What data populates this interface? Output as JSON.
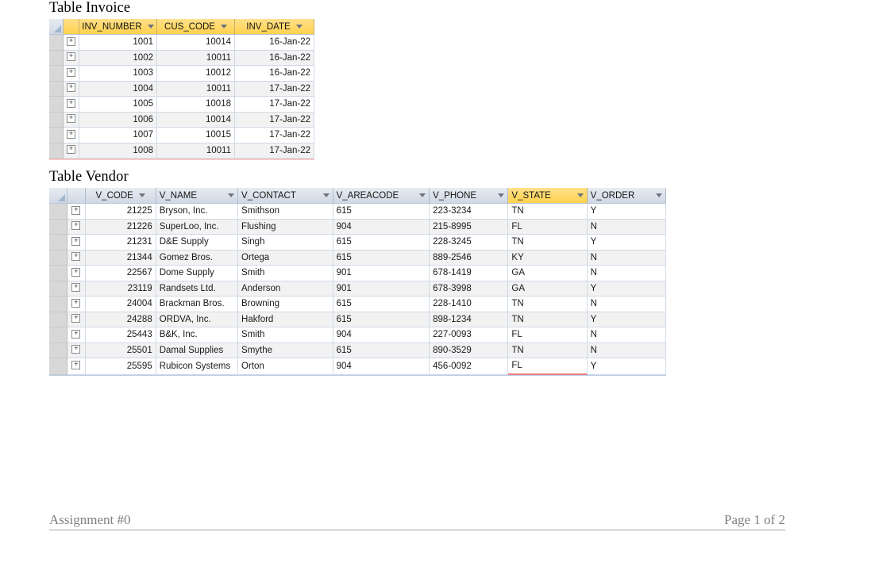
{
  "document": {
    "footer": {
      "left_text": "Assignment #0",
      "right_text": "Page 1 of 2"
    }
  },
  "invoice_section": {
    "title": "Table Invoice",
    "table": {
      "name": "Invoice",
      "columns": [
        {
          "key": "INV_NUMBER",
          "label": "INV_NUMBER",
          "align": "right",
          "highlighted": true
        },
        {
          "key": "CUS_CODE",
          "label": "CUS_CODE",
          "align": "right",
          "highlighted": true
        },
        {
          "key": "INV_DATE",
          "label": "INV_DATE",
          "align": "right",
          "highlighted": true
        }
      ],
      "rows": [
        {
          "INV_NUMBER": "1001",
          "CUS_CODE": "10014",
          "INV_DATE": "16-Jan-22"
        },
        {
          "INV_NUMBER": "1002",
          "CUS_CODE": "10011",
          "INV_DATE": "16-Jan-22"
        },
        {
          "INV_NUMBER": "1003",
          "CUS_CODE": "10012",
          "INV_DATE": "16-Jan-22"
        },
        {
          "INV_NUMBER": "1004",
          "CUS_CODE": "10011",
          "INV_DATE": "17-Jan-22"
        },
        {
          "INV_NUMBER": "1005",
          "CUS_CODE": "10018",
          "INV_DATE": "17-Jan-22"
        },
        {
          "INV_NUMBER": "1006",
          "CUS_CODE": "10014",
          "INV_DATE": "17-Jan-22"
        },
        {
          "INV_NUMBER": "1007",
          "CUS_CODE": "10015",
          "INV_DATE": "17-Jan-22"
        },
        {
          "INV_NUMBER": "1008",
          "CUS_CODE": "10011",
          "INV_DATE": "17-Jan-22"
        }
      ],
      "expand_glyph": "+"
    }
  },
  "vendor_section": {
    "title": "Table Vendor",
    "table": {
      "name": "Vendor",
      "columns": [
        {
          "key": "V_CODE",
          "label": "V_CODE",
          "align": "right",
          "highlighted": false
        },
        {
          "key": "V_NAME",
          "label": "V_NAME",
          "align": "left",
          "highlighted": false
        },
        {
          "key": "V_CONTACT",
          "label": "V_CONTACT",
          "align": "left",
          "highlighted": false
        },
        {
          "key": "V_AREACODE",
          "label": "V_AREACODE",
          "align": "left",
          "highlighted": false
        },
        {
          "key": "V_PHONE",
          "label": "V_PHONE",
          "align": "left",
          "highlighted": false
        },
        {
          "key": "V_STATE",
          "label": "V_STATE",
          "align": "left",
          "highlighted": true
        },
        {
          "key": "V_ORDER",
          "label": "V_ORDER",
          "align": "left",
          "highlighted": false
        }
      ],
      "rows": [
        {
          "V_CODE": "21225",
          "V_NAME": "Bryson, Inc.",
          "V_CONTACT": "Smithson",
          "V_AREACODE": "615",
          "V_PHONE": "223-3234",
          "V_STATE": "TN",
          "V_ORDER": "Y"
        },
        {
          "V_CODE": "21226",
          "V_NAME": "SuperLoo, Inc.",
          "V_CONTACT": "Flushing",
          "V_AREACODE": "904",
          "V_PHONE": "215-8995",
          "V_STATE": "FL",
          "V_ORDER": "N"
        },
        {
          "V_CODE": "21231",
          "V_NAME": "D&E Supply",
          "V_CONTACT": "Singh",
          "V_AREACODE": "615",
          "V_PHONE": "228-3245",
          "V_STATE": "TN",
          "V_ORDER": "Y"
        },
        {
          "V_CODE": "21344",
          "V_NAME": "Gomez Bros.",
          "V_CONTACT": "Ortega",
          "V_AREACODE": "615",
          "V_PHONE": "889-2546",
          "V_STATE": "KY",
          "V_ORDER": "N"
        },
        {
          "V_CODE": "22567",
          "V_NAME": "Dome Supply",
          "V_CONTACT": "Smith",
          "V_AREACODE": "901",
          "V_PHONE": "678-1419",
          "V_STATE": "GA",
          "V_ORDER": "N"
        },
        {
          "V_CODE": "23119",
          "V_NAME": "Randsets Ltd.",
          "V_CONTACT": "Anderson",
          "V_AREACODE": "901",
          "V_PHONE": "678-3998",
          "V_STATE": "GA",
          "V_ORDER": "Y"
        },
        {
          "V_CODE": "24004",
          "V_NAME": "Brackman Bros.",
          "V_CONTACT": "Browning",
          "V_AREACODE": "615",
          "V_PHONE": "228-1410",
          "V_STATE": "TN",
          "V_ORDER": "N"
        },
        {
          "V_CODE": "24288",
          "V_NAME": "ORDVA, Inc.",
          "V_CONTACT": "Hakford",
          "V_AREACODE": "615",
          "V_PHONE": "898-1234",
          "V_STATE": "TN",
          "V_ORDER": "Y"
        },
        {
          "V_CODE": "25443",
          "V_NAME": "B&K, Inc.",
          "V_CONTACT": "Smith",
          "V_AREACODE": "904",
          "V_PHONE": "227-0093",
          "V_STATE": "FL",
          "V_ORDER": "N"
        },
        {
          "V_CODE": "25501",
          "V_NAME": "Damal Supplies",
          "V_CONTACT": "Smythe",
          "V_AREACODE": "615",
          "V_PHONE": "890-3529",
          "V_STATE": "TN",
          "V_ORDER": "N"
        },
        {
          "V_CODE": "25595",
          "V_NAME": "Rubicon Systems",
          "V_CONTACT": "Orton",
          "V_AREACODE": "904",
          "V_PHONE": "456-0092",
          "V_STATE": "FL",
          "V_ORDER": "Y"
        }
      ],
      "expand_glyph": "+"
    }
  },
  "colors": {
    "header_highlight": "#FFD24D",
    "header_plain": "#cfd8e4",
    "grid_line": "#cfd9e6",
    "row_alt": "#f2f2f2",
    "row_selector": "#d8d8d8",
    "validation_underline": "#f08080",
    "footer_text": "#7f7f7f"
  }
}
